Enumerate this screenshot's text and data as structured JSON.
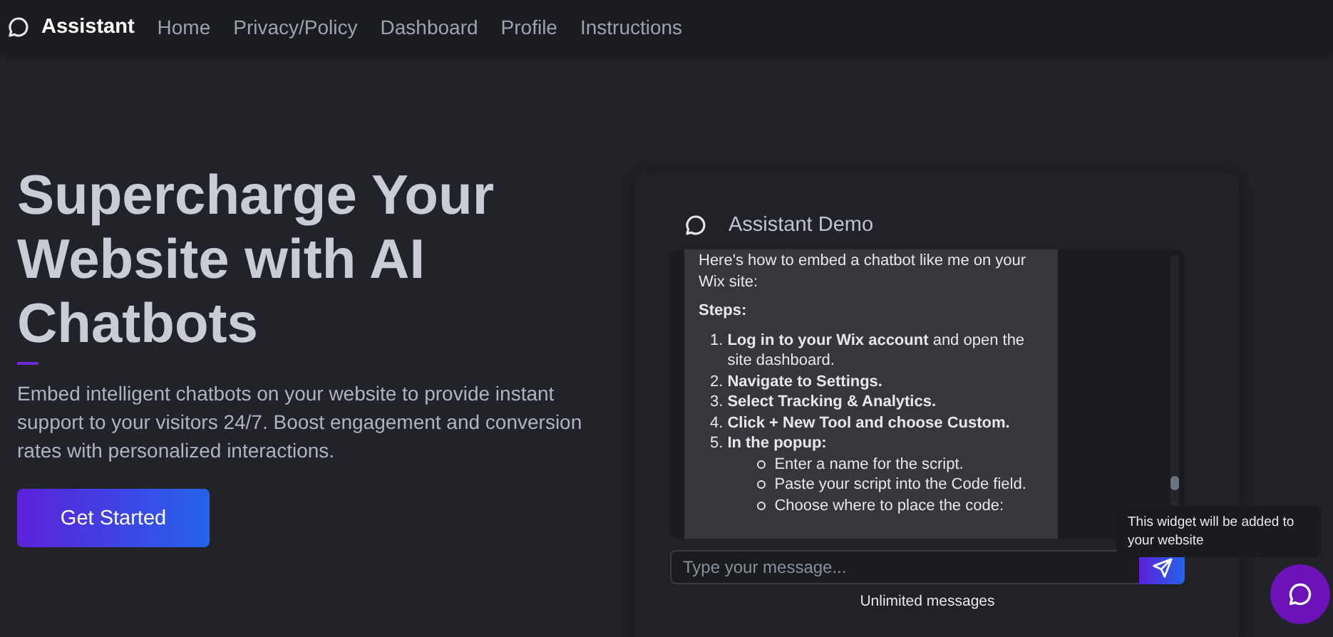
{
  "nav": {
    "brand": "Assistant",
    "links": [
      "Home",
      "Privacy/Policy",
      "Dashboard",
      "Profile",
      "Instructions"
    ]
  },
  "hero": {
    "title": "Supercharge Your Website with AI Chatbots",
    "description": "Embed intelligent chatbots on your website to provide instant support to your visitors 24/7. Boost engagement and conversion rates with personalized interactions.",
    "button": "Get Started"
  },
  "demo": {
    "title": "Assistant Demo",
    "message": {
      "intro": "Here's how to embed a chatbot like me on your Wix site:",
      "heading": "Steps:",
      "steps": [
        {
          "number": "1.",
          "text": "**Log in to your Wix account** and open the site dashboard.",
          "bold": false
        },
        {
          "number": "2.",
          "text": "Navigate to Settings.",
          "bold": true
        },
        {
          "number": "3.",
          "text": "Select Tracking & Analytics.",
          "bold": true
        },
        {
          "number": "4.",
          "text": "Click + New Tool and choose Custom.",
          "bold": true
        },
        {
          "number": "5.",
          "text": "In the popup:",
          "bold": true,
          "children": [
            "Enter a name for the script.",
            "Paste your script into the Code field.",
            "Choose where to place the code:"
          ]
        }
      ]
    },
    "input": {
      "placeholder": "Type your message..."
    },
    "footer": "Unlimited messages"
  },
  "tooltip": "This widget will be added to your website"
}
